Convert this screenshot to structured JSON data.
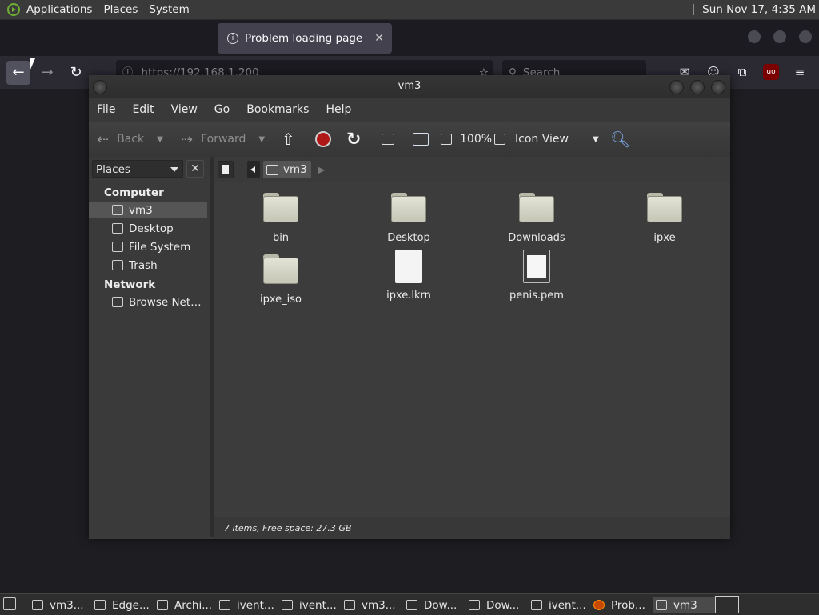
{
  "top_panel": {
    "menus": [
      "Applications",
      "Places",
      "System"
    ],
    "clock": "Sun Nov 17,  4:35 AM"
  },
  "firefox": {
    "active_tab_title": "Problem loading page",
    "url": "https://192.168.1.200",
    "search_placeholder": "Search"
  },
  "window": {
    "title": "vm3",
    "menu": [
      "File",
      "Edit",
      "View",
      "Go",
      "Bookmarks",
      "Help"
    ],
    "toolbar": {
      "back": "Back",
      "forward": "Forward",
      "zoom": "100%",
      "view_mode": "Icon View"
    },
    "sidebar": {
      "selector": "Places",
      "sections": [
        {
          "heading": "Computer",
          "items": [
            "vm3",
            "Desktop",
            "File System",
            "Trash"
          ]
        },
        {
          "heading": "Network",
          "items": [
            "Browse Net…"
          ]
        }
      ],
      "selected": "vm3"
    },
    "path": [
      "vm3"
    ],
    "items": [
      {
        "name": "bin",
        "type": "folder"
      },
      {
        "name": "Desktop",
        "type": "folder"
      },
      {
        "name": "Downloads",
        "type": "folder"
      },
      {
        "name": "ipxe",
        "type": "folder"
      },
      {
        "name": "ipxe_iso",
        "type": "folder"
      },
      {
        "name": "ipxe.lkrn",
        "type": "file"
      },
      {
        "name": "penis.pem",
        "type": "document"
      }
    ],
    "status": "7 items, Free space: 27.3 GB"
  },
  "taskbar": {
    "tasks": [
      "vm3...",
      "Edge...",
      "Archi...",
      "ivent...",
      "ivent...",
      "vm3...",
      "Dow...",
      "Dow...",
      "ivent...",
      "Prob...",
      "vm3"
    ],
    "active": "vm3"
  }
}
